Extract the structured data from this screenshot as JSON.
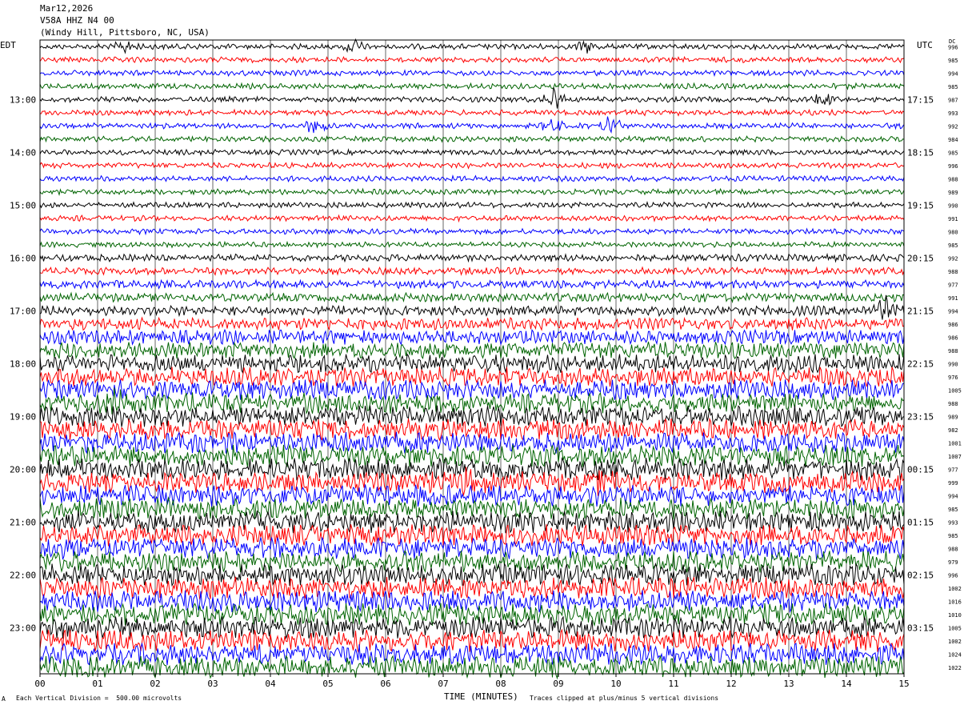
{
  "header": {
    "date": "Mar12,2026",
    "station": "V58A HHZ N4 00",
    "location": "(Windy Hill, Pittsboro, NC, USA)"
  },
  "left_zone": "EDT",
  "right_zone": "UTC",
  "dc_label": "DC",
  "footer": {
    "scale_note": "Each Vertical Division =  500.00 microvolts",
    "xlabel": "TIME (MINUTES)",
    "clip_note": "Traces clipped at plus/minus 5 vertical divisions",
    "corner_mark": "A"
  },
  "chart_data": {
    "type": "line",
    "title": "V58A HHZ N4 00",
    "xlabel": "TIME (MINUTES)",
    "ylabel": "",
    "xlim": [
      0,
      15
    ],
    "x_ticks": [
      "00",
      "01",
      "02",
      "03",
      "04",
      "05",
      "06",
      "07",
      "08",
      "09",
      "10",
      "11",
      "12",
      "13",
      "14",
      "15"
    ],
    "left_time_labels": [
      "13:00",
      "14:00",
      "15:00",
      "16:00",
      "17:00",
      "18:00",
      "19:00",
      "20:00",
      "21:00",
      "22:00",
      "23:00"
    ],
    "right_time_labels": [
      "17:15",
      "18:15",
      "19:15",
      "20:15",
      "21:15",
      "22:15",
      "23:15",
      "00:15",
      "01:15",
      "02:15",
      "03:15"
    ],
    "trace_colors": [
      "#000000",
      "#ff0000",
      "#0000ff",
      "#006400"
    ],
    "dc_offsets": [
      996,
      985,
      994,
      985,
      987,
      993,
      992,
      984,
      985,
      996,
      988,
      989,
      990,
      991,
      980,
      985,
      992,
      988,
      977,
      991,
      994,
      986,
      986,
      988,
      990,
      976,
      1005,
      988,
      989,
      982,
      1001,
      1007,
      977,
      999,
      994,
      985,
      993,
      985,
      988,
      979,
      996,
      1002,
      1016,
      1010,
      1005,
      1002,
      1024,
      1022
    ],
    "trace_amplitude_level": [
      1,
      1,
      1,
      1,
      1,
      1,
      1,
      1,
      1,
      1,
      1,
      1,
      1,
      1,
      1,
      1,
      1.3,
      1.3,
      1.5,
      1.6,
      1.8,
      2.2,
      2.6,
      3,
      3.3,
      3.5,
      3.6,
      3.7,
      3.8,
      3.8,
      3.8,
      3.9,
      3.9,
      3.9,
      3.9,
      3.9,
      3.9,
      3.9,
      3.9,
      3.9,
      3.9,
      3.9,
      3.9,
      3.9,
      3.9,
      3.9,
      3.9,
      3.9
    ],
    "events": [
      {
        "trace": 0,
        "minute": 1.5,
        "level": 2.5
      },
      {
        "trace": 0,
        "minute": 5.4,
        "level": 2.8
      },
      {
        "trace": 0,
        "minute": 9.5,
        "level": 2
      },
      {
        "trace": 4,
        "minute": 8.9,
        "level": 4.5
      },
      {
        "trace": 4,
        "minute": 13.6,
        "level": 2.5
      },
      {
        "trace": 6,
        "minute": 4.8,
        "level": 2.5
      },
      {
        "trace": 6,
        "minute": 8.9,
        "level": 2.5
      },
      {
        "trace": 6,
        "minute": 9.9,
        "level": 3.5
      },
      {
        "trace": 20,
        "minute": 14.7,
        "level": 4
      },
      {
        "trace": 27,
        "minute": 1.3,
        "level": 2.5
      },
      {
        "trace": 33,
        "minute": 7.5,
        "level": 3
      },
      {
        "trace": 33,
        "minute": 9.8,
        "level": 3
      }
    ],
    "grid": true,
    "legend": "none"
  }
}
